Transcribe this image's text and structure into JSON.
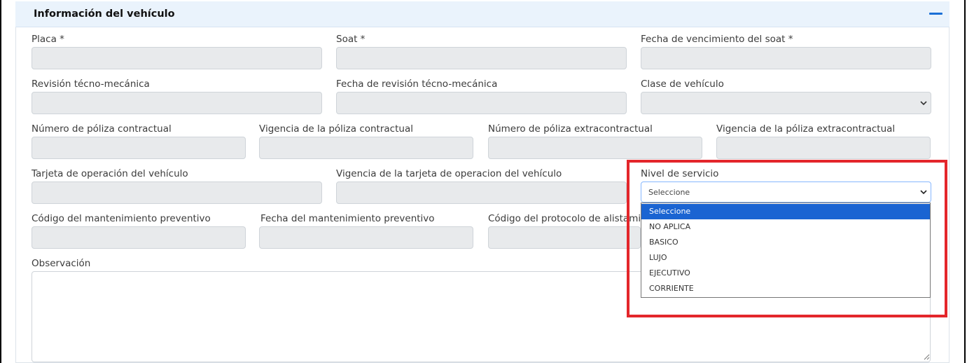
{
  "panel": {
    "title": "Información del vehículo"
  },
  "fields": {
    "placa": "Placa *",
    "soat": "Soat *",
    "fecha_soat": "Fecha de vencimiento del soat *",
    "revision": "Revisión técno-mecánica",
    "fecha_revision": "Fecha de revisión técno-mecánica",
    "clase": "Clase de vehículo",
    "num_poliza_contractual": "Número de póliza contractual",
    "vig_poliza_contractual": "Vigencia de la póliza contractual",
    "num_poliza_extra": "Número de póliza extracontractual",
    "vig_poliza_extra": "Vigencia de la póliza extracontractual",
    "tarjeta": "Tarjeta de operación del vehículo",
    "vig_tarjeta": "Vigencia de la tarjeta de operacion del vehículo",
    "nivel": "Nivel de servicio",
    "cod_mant": "Código del mantenimiento preventivo",
    "fecha_mant": "Fecha del mantenimiento preventivo",
    "cod_protocolo": "Código del protocolo de alistami",
    "observacion": "Observación"
  },
  "nivel_select": {
    "value": "Seleccione",
    "options": [
      "Seleccione",
      "NO APLICA",
      "BASICO",
      "LUJO",
      "EJECUTIVO",
      "CORRIENTE"
    ],
    "selected_index": 0
  },
  "colors": {
    "accent": "#1a64d2",
    "highlight": "#e3262b",
    "header_bg": "#eaf3fc"
  },
  "icons": {
    "collapse": "minus-icon",
    "select": "chevron-down-icon",
    "resize": "resize-handle-icon"
  }
}
